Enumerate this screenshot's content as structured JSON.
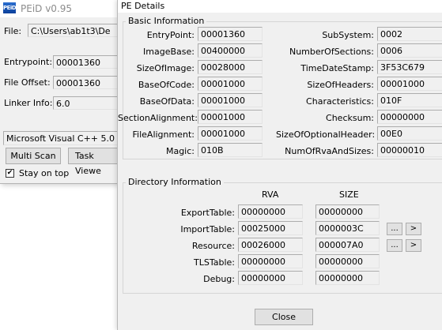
{
  "peid": {
    "title": "PEiD v0.95",
    "file_label": "File:",
    "file_value": "C:\\Users\\ab1t3\\De",
    "entrypoint_label": "Entrypoint:",
    "entrypoint_value": "00001360",
    "file_offset_label": "File Offset:",
    "file_offset_value": "00001360",
    "linker_info_label": "Linker Info:",
    "linker_info_value": "6.0",
    "detected": "Microsoft Visual C++ 5.0",
    "multi_scan_label": "Multi Scan",
    "task_viewer_label": "Task Viewe",
    "stay_on_top_label": "Stay on top",
    "stay_on_top_checked": true
  },
  "pe_details": {
    "title": "PE Details",
    "basic_info_title": "Basic Information",
    "basic_left": [
      {
        "label": "EntryPoint:",
        "value": "00001360"
      },
      {
        "label": "ImageBase:",
        "value": "00400000"
      },
      {
        "label": "SizeOfImage:",
        "value": "00028000"
      },
      {
        "label": "BaseOfCode:",
        "value": "00001000"
      },
      {
        "label": "BaseOfData:",
        "value": "00001000"
      },
      {
        "label": "SectionAlignment:",
        "value": "00001000"
      },
      {
        "label": "FileAlignment:",
        "value": "00001000"
      },
      {
        "label": "Magic:",
        "value": "010B"
      }
    ],
    "basic_right": [
      {
        "label": "SubSystem:",
        "value": "0002"
      },
      {
        "label": "NumberOfSections:",
        "value": "0006"
      },
      {
        "label": "TimeDateStamp:",
        "value": "3F53C679"
      },
      {
        "label": "SizeOfHeaders:",
        "value": "00001000"
      },
      {
        "label": "Characteristics:",
        "value": "010F"
      },
      {
        "label": "Checksum:",
        "value": "00000000"
      },
      {
        "label": "SizeOfOptionalHeader:",
        "value": "00E0"
      },
      {
        "label": "NumOfRvaAndSizes:",
        "value": "00000010"
      }
    ],
    "directory_info_title": "Directory Information",
    "rva_header": "RVA",
    "size_header": "SIZE",
    "directories": [
      {
        "label": "ExportTable:",
        "rva": "00000000",
        "size": "00000000"
      },
      {
        "label": "ImportTable:",
        "rva": "00025000",
        "size": "0000003C"
      },
      {
        "label": "Resource:",
        "rva": "00026000",
        "size": "000007A0"
      },
      {
        "label": "TLSTable:",
        "rva": "00000000",
        "size": "00000000"
      },
      {
        "label": "Debug:",
        "rva": "00000000",
        "size": "00000000"
      }
    ],
    "more_button_label": "...",
    "arrow_button_label": ">",
    "close_label": "Close"
  }
}
